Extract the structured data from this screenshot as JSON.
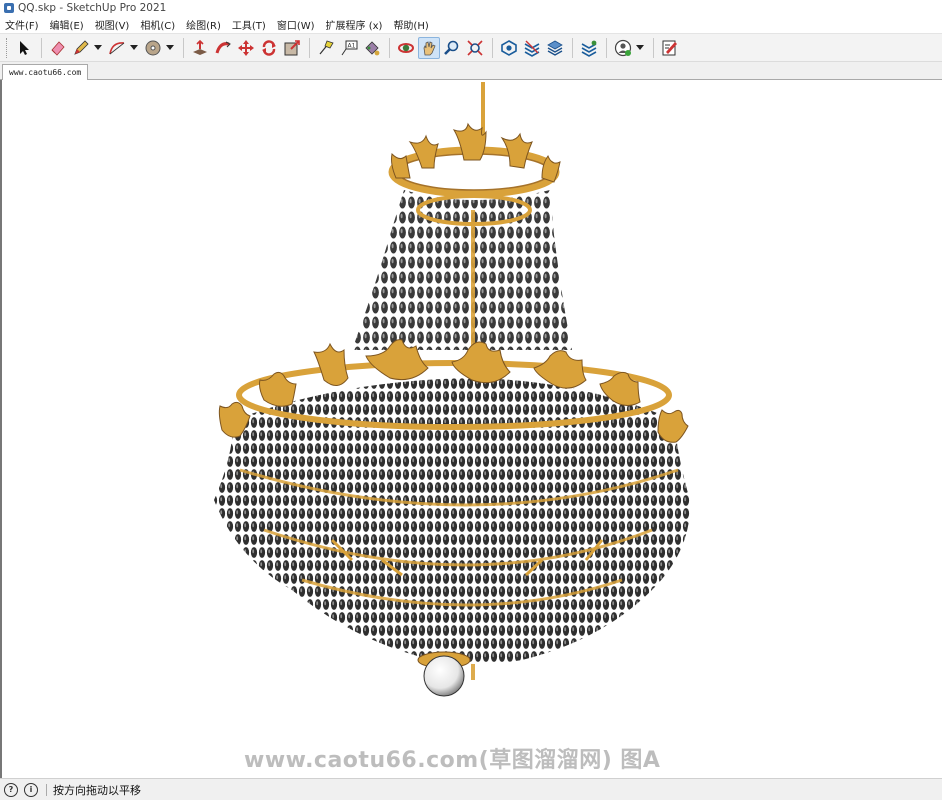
{
  "window": {
    "title": "QQ.skp - SketchUp Pro 2021"
  },
  "menu": [
    "文件(F)",
    "编辑(E)",
    "视图(V)",
    "相机(C)",
    "绘图(R)",
    "工具(T)",
    "窗口(W)",
    "扩展程序 (x)",
    "帮助(H)"
  ],
  "toolbar": {
    "tools": [
      "select-tool",
      "eraser-tool",
      "pencil-tool",
      "arc-tool",
      "shape-tool",
      "push-pull-tool",
      "follow-me-tool",
      "move-tool",
      "rotate-tool",
      "scale-tool",
      "tape-measure-tool",
      "text-tool",
      "paint-bucket-tool",
      "orbit-tool",
      "pan-tool",
      "zoom-tool",
      "zoom-extents-tool",
      "warehouse-tool",
      "extension-warehouse-tool",
      "layout-send-tool",
      "extension-manager-tool",
      "account-tool",
      "feedback-tool"
    ],
    "active": "pan-tool"
  },
  "scene_tab": {
    "label": "www.caotu66.com"
  },
  "watermark": "www.caotu66.com(草图溜溜网) 图A",
  "status": {
    "hint": "按方向拖动以平移"
  },
  "colors": {
    "gold": "#d9a23a",
    "bead": "#3a3a3a",
    "toolbar_bg": "#f3f3f3",
    "active_tool": "#cfe3f7"
  }
}
